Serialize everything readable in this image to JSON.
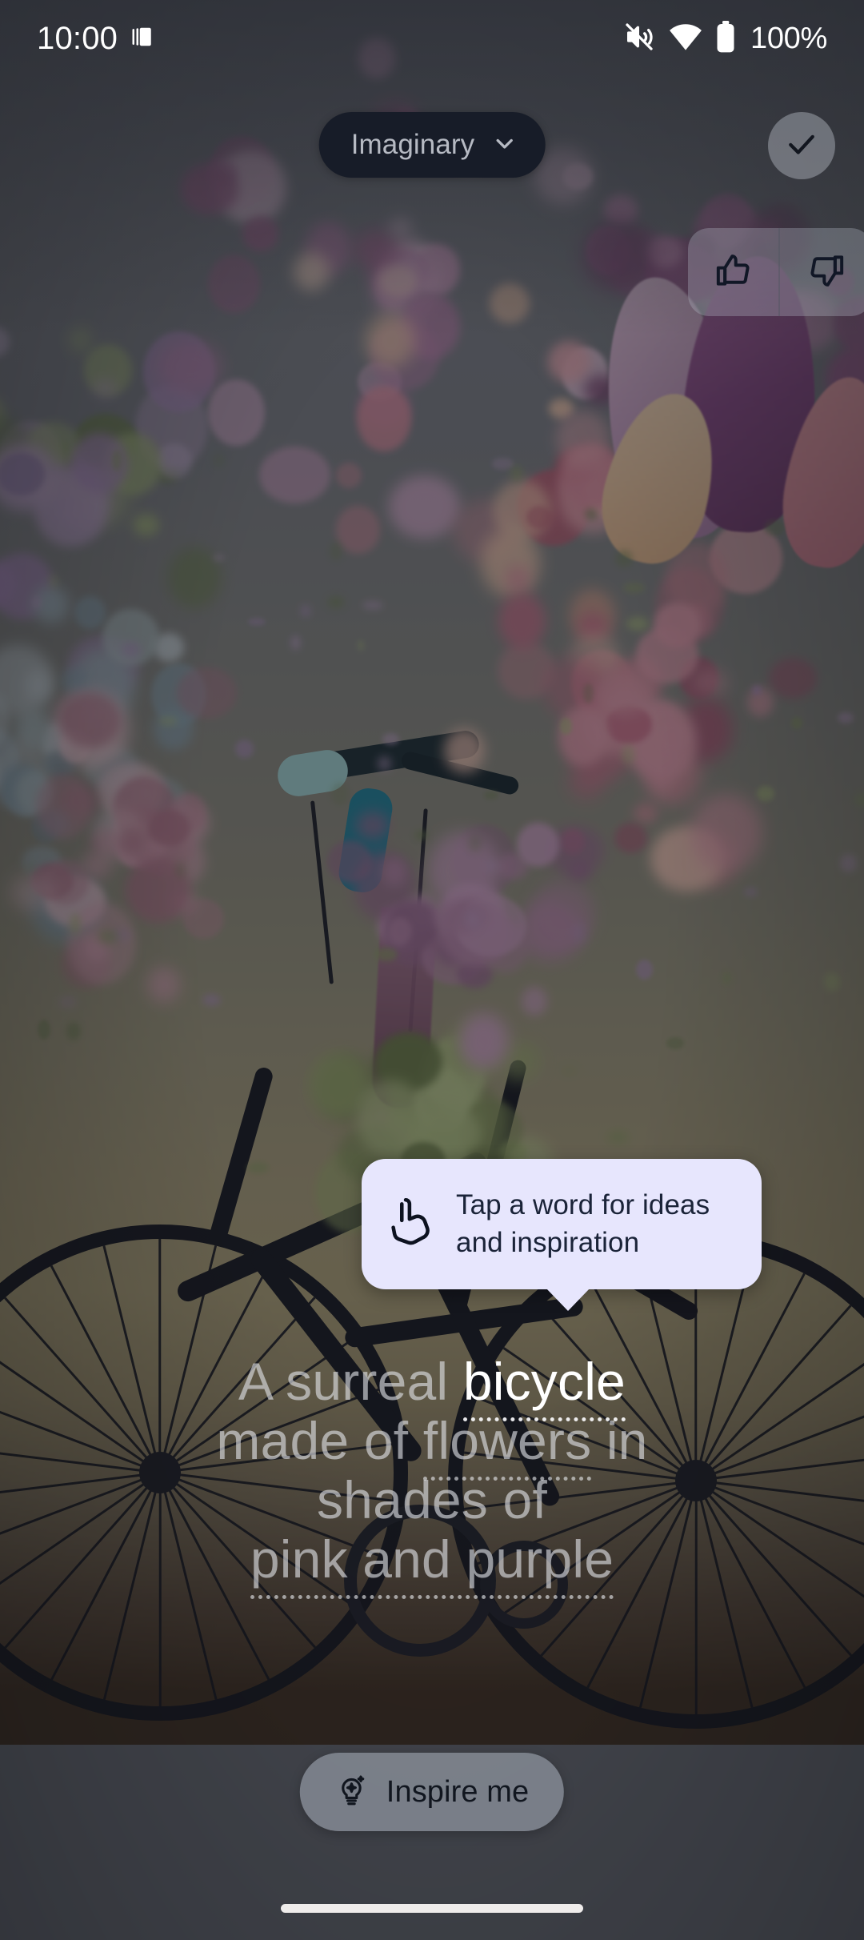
{
  "status_bar": {
    "time": "10:00",
    "icons": [
      "burst-mode-icon",
      "silent-mode-icon",
      "wifi-icon",
      "battery-icon"
    ],
    "battery_percent": "100%"
  },
  "top_bar": {
    "model_chip_label": "Imaginary",
    "model_chip_icon": "chevron-down-icon",
    "confirm_icon": "check-icon"
  },
  "feedback": {
    "thumbs_up_icon": "thumb-up-icon",
    "thumbs_down_icon": "thumb-down-icon"
  },
  "tooltip": {
    "icon": "tap-hand-icon",
    "text": "Tap a word for ideas and inspiration"
  },
  "prompt": {
    "lines": [
      [
        {
          "text": "A surreal ",
          "highlight": false,
          "underline": "none"
        },
        {
          "text": "bicycle",
          "highlight": true,
          "underline": "bright"
        }
      ],
      [
        {
          "text": "made of ",
          "highlight": false,
          "underline": "none"
        },
        {
          "text": "flowers",
          "highlight": false,
          "underline": "dim"
        },
        {
          "text": " in",
          "highlight": false,
          "underline": "none"
        }
      ],
      [
        {
          "text": "shades of",
          "highlight": false,
          "underline": "none"
        }
      ],
      [
        {
          "text": "pink and purple",
          "highlight": false,
          "underline": "dim"
        }
      ]
    ],
    "full_text": "A surreal bicycle made of flowers in shades of pink and purple",
    "selected_word": "bicycle"
  },
  "inspire": {
    "label": "Inspire me",
    "icon": "lightbulb-sparkle-icon"
  },
  "nav": {
    "gesture_bar": "home-gesture-bar"
  },
  "colors": {
    "chip_bg": "#171c28",
    "chip_text": "#b6bac3",
    "tooltip_bg": "#e7e6fd",
    "tooltip_text": "#1a2338",
    "prompt_dim": "rgba(226,228,232,0.62)",
    "prompt_highlight": "#ffffff",
    "inspire_bg": "rgba(162,168,180,0.60)",
    "status_text": "#ffffff"
  }
}
